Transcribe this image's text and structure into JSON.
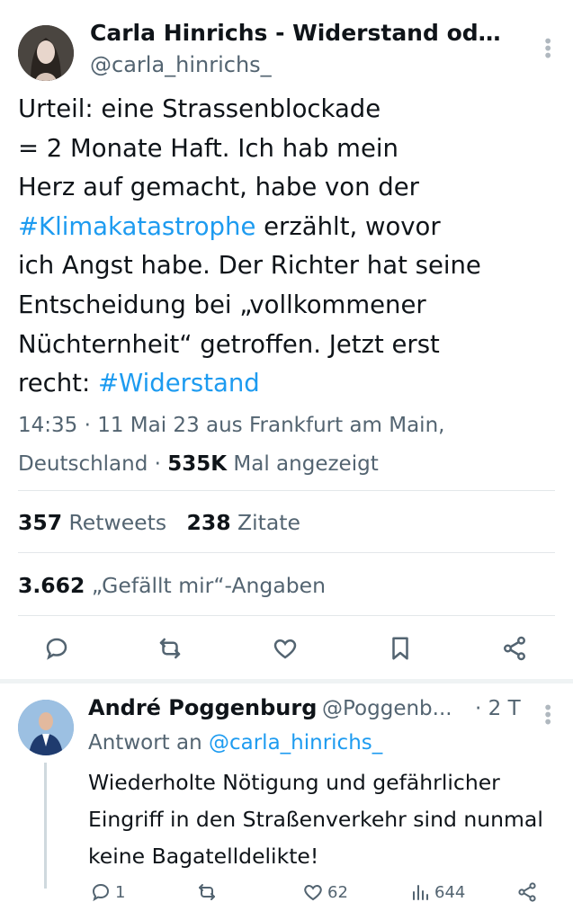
{
  "tweet": {
    "author_name": "Carla Hinrichs - Widerstand oder...",
    "handle": "@carla_hinrichs_",
    "text_lines": [
      "Urteil: eine Strassenblockade",
      "= 2 Monate Haft. Ich hab mein",
      "Herz auf gemacht, habe von der",
      "ich Angst habe. Der Richter hat seine",
      "Entscheidung bei „vollkommener",
      "Nüchternheit“ getroffen. Jetzt erst",
      "recht: "
    ],
    "hashtag_1": "#Klimakatastrophe",
    "after_hashtag_1": " erzählt, wovor",
    "hashtag_2": "#Widerstand",
    "meta_line1": "14:35 · 11 Mai 23 aus Frankfurt am Main,",
    "meta_line2_prefix": "Deutschland · ",
    "views_count": "535K",
    "views_label": " Mal angezeigt",
    "retweets_count": "357",
    "retweets_label": " Retweets",
    "quotes_count": "238",
    "quotes_label": " Zitate",
    "likes_count": "3.662",
    "likes_label": " „Gefällt mir“-Angaben",
    "icons": [
      "reply-icon",
      "retweet-icon",
      "like-icon",
      "bookmark-icon",
      "share-icon"
    ]
  },
  "reply": {
    "author_name": "André Poggenburg",
    "handle": "@Poggenb...",
    "time": "· 2 T",
    "reply_to_label": "Antwort an ",
    "reply_to_handle": "@carla_hinrichs_",
    "text": "Wiederholte Nötigung und gefährlicher Eingriff in den Straßenverkehr sind nunmal keine Bagatelldelikte!",
    "reply_count": "1",
    "like_count": "62",
    "view_count": "644"
  },
  "colors": {
    "accent": "#1d9bf0",
    "text": "#0f1419",
    "secondary": "#536471",
    "divider": "#e3e7ea"
  }
}
